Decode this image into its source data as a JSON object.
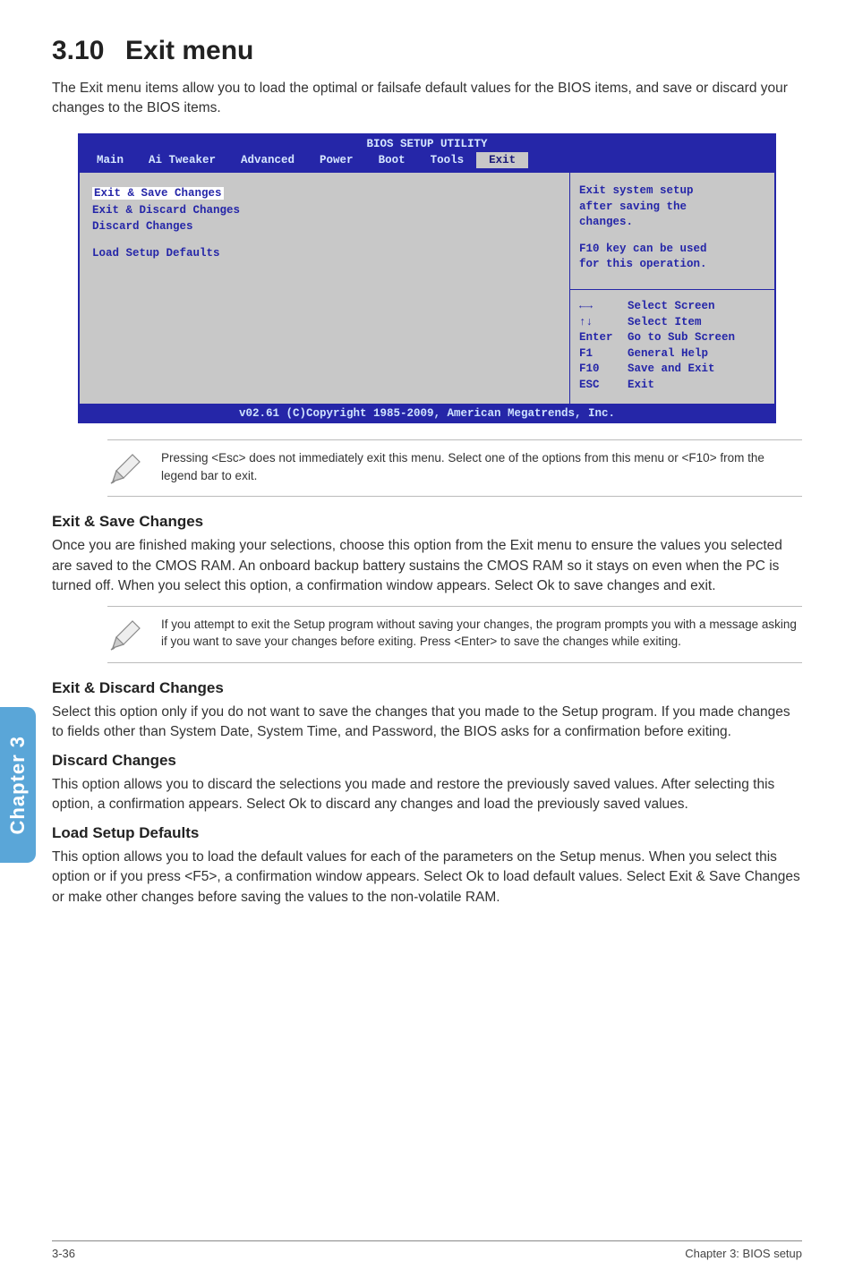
{
  "heading": {
    "number": "3.10",
    "title": "Exit menu"
  },
  "intro": "The Exit menu items allow you to load the optimal or failsafe default values for the BIOS items, and save or discard your changes to the BIOS items.",
  "bios": {
    "title": "BIOS SETUP UTILITY",
    "tabs": [
      "Main",
      "Ai Tweaker",
      "Advanced",
      "Power",
      "Boot",
      "Tools",
      "Exit"
    ],
    "active_tab": "Exit",
    "left_items": [
      "Exit & Save Changes",
      "Exit & Discard Changes",
      "Discard Changes",
      "Load Setup Defaults"
    ],
    "help_top": [
      "Exit system setup",
      "after saving the",
      "changes.",
      "",
      "F10 key can be used",
      "for this operation."
    ],
    "legend": [
      {
        "k": "←→",
        "v": "Select Screen"
      },
      {
        "k": "↑↓",
        "v": "Select Item"
      },
      {
        "k": "Enter",
        "v": "Go to Sub Screen"
      },
      {
        "k": "F1",
        "v": "General Help"
      },
      {
        "k": "F10",
        "v": "Save and Exit"
      },
      {
        "k": "ESC",
        "v": "Exit"
      }
    ],
    "footer": "v02.61 (C)Copyright 1985-2009, American Megatrends, Inc."
  },
  "note1": "Pressing <Esc> does not immediately exit this menu. Select one of the options from this menu or <F10> from the legend bar to exit.",
  "sections": {
    "save": {
      "title": "Exit & Save Changes",
      "body": "Once you are finished making your selections, choose this option from the Exit menu to ensure the values you selected are saved to the CMOS RAM. An onboard backup battery sustains the CMOS RAM so it stays on even when the PC is turned off. When you select this option, a confirmation window appears. Select Ok to save changes and exit."
    },
    "note2": "If you attempt to exit the Setup program without saving your changes, the program prompts you with a message asking if you want to save your changes before exiting. Press <Enter> to save the changes while exiting.",
    "discard_exit": {
      "title": "Exit & Discard Changes",
      "body": "Select this option only if you do not want to save the changes that you  made to the Setup program. If you made changes to fields other than System Date, System Time, and Password, the BIOS asks for a confirmation before exiting."
    },
    "discard": {
      "title": "Discard Changes",
      "body": "This option allows you to discard the selections you made and restore the previously saved values. After selecting this option, a confirmation appears. Select Ok to discard any changes and load the previously saved values."
    },
    "defaults": {
      "title": "Load Setup Defaults",
      "body": "This option allows you to load the default values for each of the parameters on the Setup menus. When you select this option or if you press <F5>, a confirmation window appears. Select Ok to load default values. Select Exit & Save Changes or make other changes before saving the values to the non-volatile RAM."
    }
  },
  "side_tab": "Chapter 3",
  "footer": {
    "left": "3-36",
    "right": "Chapter 3: BIOS setup"
  }
}
